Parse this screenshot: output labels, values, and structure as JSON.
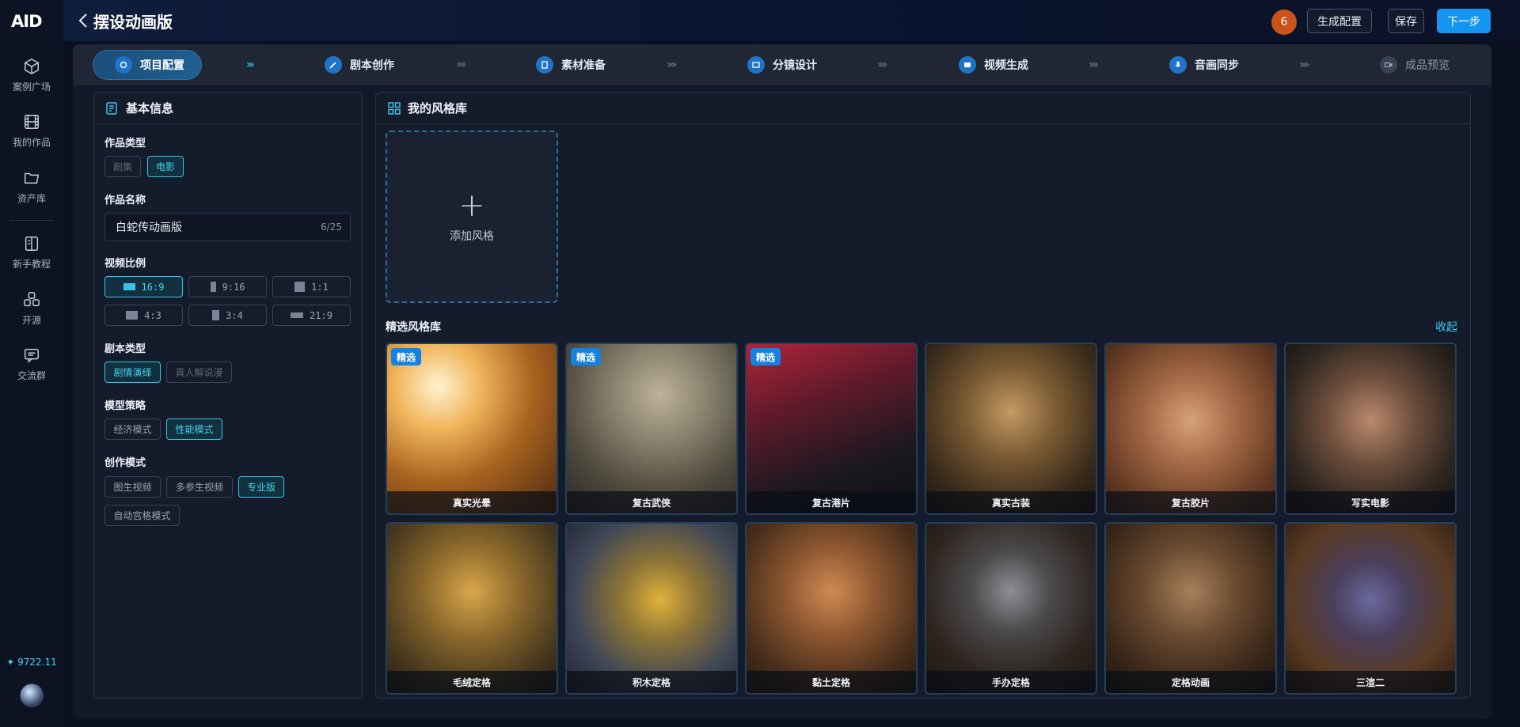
{
  "rail": {
    "logo_text": "AID",
    "items": [
      {
        "label": "案例广场",
        "icon": "cube-icon"
      },
      {
        "label": "我的作品",
        "icon": "film-icon"
      },
      {
        "label": "资产库",
        "icon": "folder-icon"
      },
      {
        "label": "新手教程",
        "icon": "book-icon"
      },
      {
        "label": "开源",
        "icon": "nodes-icon"
      },
      {
        "label": "交流群",
        "icon": "chat-icon"
      }
    ],
    "credits": "9722.11"
  },
  "topbar": {
    "title": "摆设动画版",
    "notification_count": "6",
    "buttons": {
      "config": "生成配置",
      "save": "保存",
      "next": "下一步"
    }
  },
  "steps": [
    {
      "label": "项目配置",
      "state": "active"
    },
    {
      "label": "剧本创作",
      "state": "normal"
    },
    {
      "label": "素材准备",
      "state": "normal"
    },
    {
      "label": "分镜设计",
      "state": "normal"
    },
    {
      "label": "视频生成",
      "state": "normal"
    },
    {
      "label": "音画同步",
      "state": "normal"
    },
    {
      "label": "成品预览",
      "state": "disabled"
    }
  ],
  "basic_info": {
    "title": "基本信息",
    "work_type": {
      "label": "作品类型",
      "options": [
        "剧集",
        "电影"
      ],
      "selected": "电影"
    },
    "work_name": {
      "label": "作品名称",
      "value": "白蛇传动画版",
      "counter": "6/25"
    },
    "ratio": {
      "label": "视频比例",
      "options": [
        "16:9",
        "9:16",
        "1:1",
        "4:3",
        "3:4",
        "21:9"
      ],
      "selected": "16:9"
    },
    "script_type": {
      "label": "剧本类型",
      "options": [
        "剧情演绎",
        "真人解说漫"
      ],
      "selected": "剧情演绎"
    },
    "model_strategy": {
      "label": "模型策略",
      "options": [
        "经济模式",
        "性能模式"
      ],
      "selected": "性能模式"
    },
    "creation_mode": {
      "label": "创作模式",
      "options": [
        "图生视频",
        "多参生视频",
        "专业版",
        "自动宫格模式"
      ],
      "selected": "专业版"
    }
  },
  "style_library": {
    "title": "我的风格库",
    "add_label": "添加风格",
    "featured_title": "精选风格库",
    "collapse_label": "收起",
    "featured_tag": "精选",
    "cards": [
      {
        "label": "真实光晕",
        "featured": true
      },
      {
        "label": "复古武侠",
        "featured": true
      },
      {
        "label": "复古港片",
        "featured": true
      },
      {
        "label": "真实古装",
        "featured": false
      },
      {
        "label": "复古胶片",
        "featured": false
      },
      {
        "label": "写实电影",
        "featured": false
      },
      {
        "label": "毛绒定格",
        "featured": false
      },
      {
        "label": "积木定格",
        "featured": false
      },
      {
        "label": "黏土定格",
        "featured": false
      },
      {
        "label": "手办定格",
        "featured": false
      },
      {
        "label": "定格动画",
        "featured": false
      },
      {
        "label": "三渲二",
        "featured": false
      }
    ]
  },
  "colors": {
    "accent": "#34c6e8",
    "primary": "#1496f0",
    "badge": "#c9531a"
  }
}
